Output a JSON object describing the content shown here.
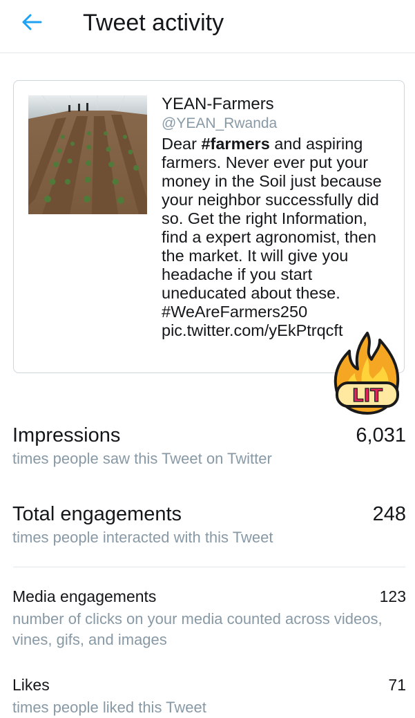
{
  "header": {
    "title": "Tweet activity",
    "back_icon": "arrow-left-icon"
  },
  "tweet": {
    "author_name": "YEAN-Farmers",
    "author_handle": "@YEAN_Rwanda",
    "text_part1": "Dear ",
    "text_hashtag": "#farmers",
    "text_part2": " and aspiring farmers. Never ever put your money in the Soil just because your neighbor successfully did so. Get the right Information, find a expert agronomist, then the market. It will give you headache if you start uneducated about these.",
    "hashtag_line": "#WeAreFarmers250",
    "link": "pic.twitter.com/yEkPtrqcft",
    "image": "greenhouse-farm-photo"
  },
  "sticker": {
    "text": "LIT",
    "icon": "flame-icon"
  },
  "metrics": {
    "impressions": {
      "label": "Impressions",
      "value": "6,031",
      "desc": "times people saw this Tweet on Twitter"
    },
    "total_engagements": {
      "label": "Total engagements",
      "value": "248",
      "desc": "times people interacted with this Tweet"
    },
    "media_engagements": {
      "label": "Media engagements",
      "value": "123",
      "desc": "number of clicks on your media counted across videos, vines, gifs, and images"
    },
    "likes": {
      "label": "Likes",
      "value": "71",
      "desc": "times people liked this Tweet"
    }
  },
  "colors": {
    "accent": "#1da1f2",
    "secondary_text": "#8899a6",
    "border": "#ccd6dd"
  }
}
